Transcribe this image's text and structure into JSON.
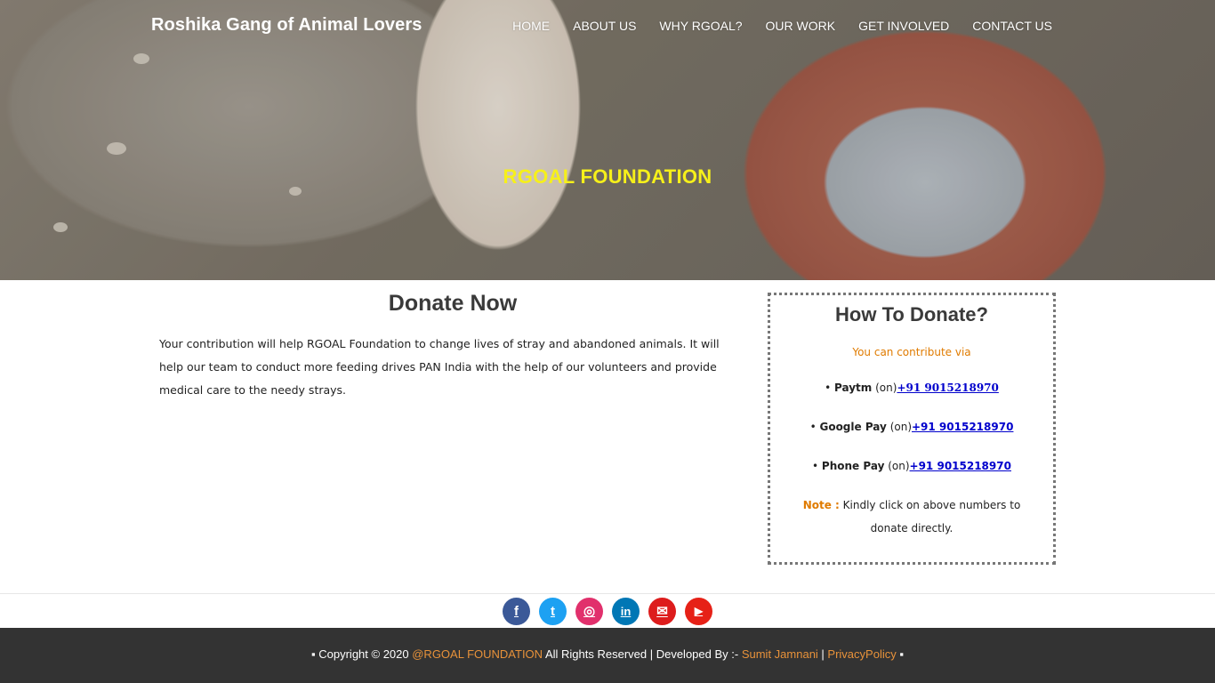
{
  "header": {
    "brand": "Roshika Gang of Animal Lovers",
    "nav": [
      "HOME",
      "ABOUT US",
      "WHY RGOAL?",
      "OUR WORK",
      "GET INVOLVED",
      "CONTACT US"
    ]
  },
  "hero": {
    "title": "RGOAL FOUNDATION"
  },
  "donate": {
    "title": "Donate Now",
    "text": "Your contribution will help RGOAL Foundation to change lives of stray and abandoned animals. It will help our team to conduct more feeding drives PAN India with the help of our volunteers and provide medical care to the needy strays."
  },
  "how": {
    "title": "How To Donate?",
    "subtitle": "You can contribute via",
    "methods": [
      {
        "bullet": "•",
        "name": "Paytm",
        "on": "(on)",
        "number": "+91 9015218970"
      },
      {
        "bullet": "•",
        "name": "Google Pay",
        "on": "(on)",
        "number": "+91 9015218970"
      },
      {
        "bullet": "•",
        "name": "Phone Pay",
        "on": "(on)",
        "number": "+91 9015218970"
      }
    ],
    "note_label": "Note :",
    "note_text": " Kindly click on above numbers to donate directly."
  },
  "social": [
    {
      "name": "facebook",
      "glyph": "f",
      "color": "#3b5998"
    },
    {
      "name": "twitter",
      "glyph": "t",
      "color": "#1da1f2"
    },
    {
      "name": "instagram",
      "glyph": "◎",
      "color": "#e1306c"
    },
    {
      "name": "linkedin",
      "glyph": "in",
      "color": "#0077b5"
    },
    {
      "name": "email",
      "glyph": "✉",
      "color": "#dd1c1c"
    },
    {
      "name": "youtube",
      "glyph": "▶",
      "color": "#e62117"
    }
  ],
  "footer": {
    "prefix": "▪ Copyright © 2020 ",
    "org_link": "@RGOAL FOUNDATION",
    "middle": " All Rights Reserved | Developed By :- ",
    "dev_link": "Sumit Jamnani",
    "sep": " | ",
    "privacy_link": "PrivacyPolicy",
    "suffix": " ▪"
  },
  "colors": {
    "hero_title": "#f6f01a",
    "accent_orange": "#e07b00",
    "link_blue": "#0000cc",
    "footer_bg": "#333333",
    "footer_link": "#e8923a"
  }
}
